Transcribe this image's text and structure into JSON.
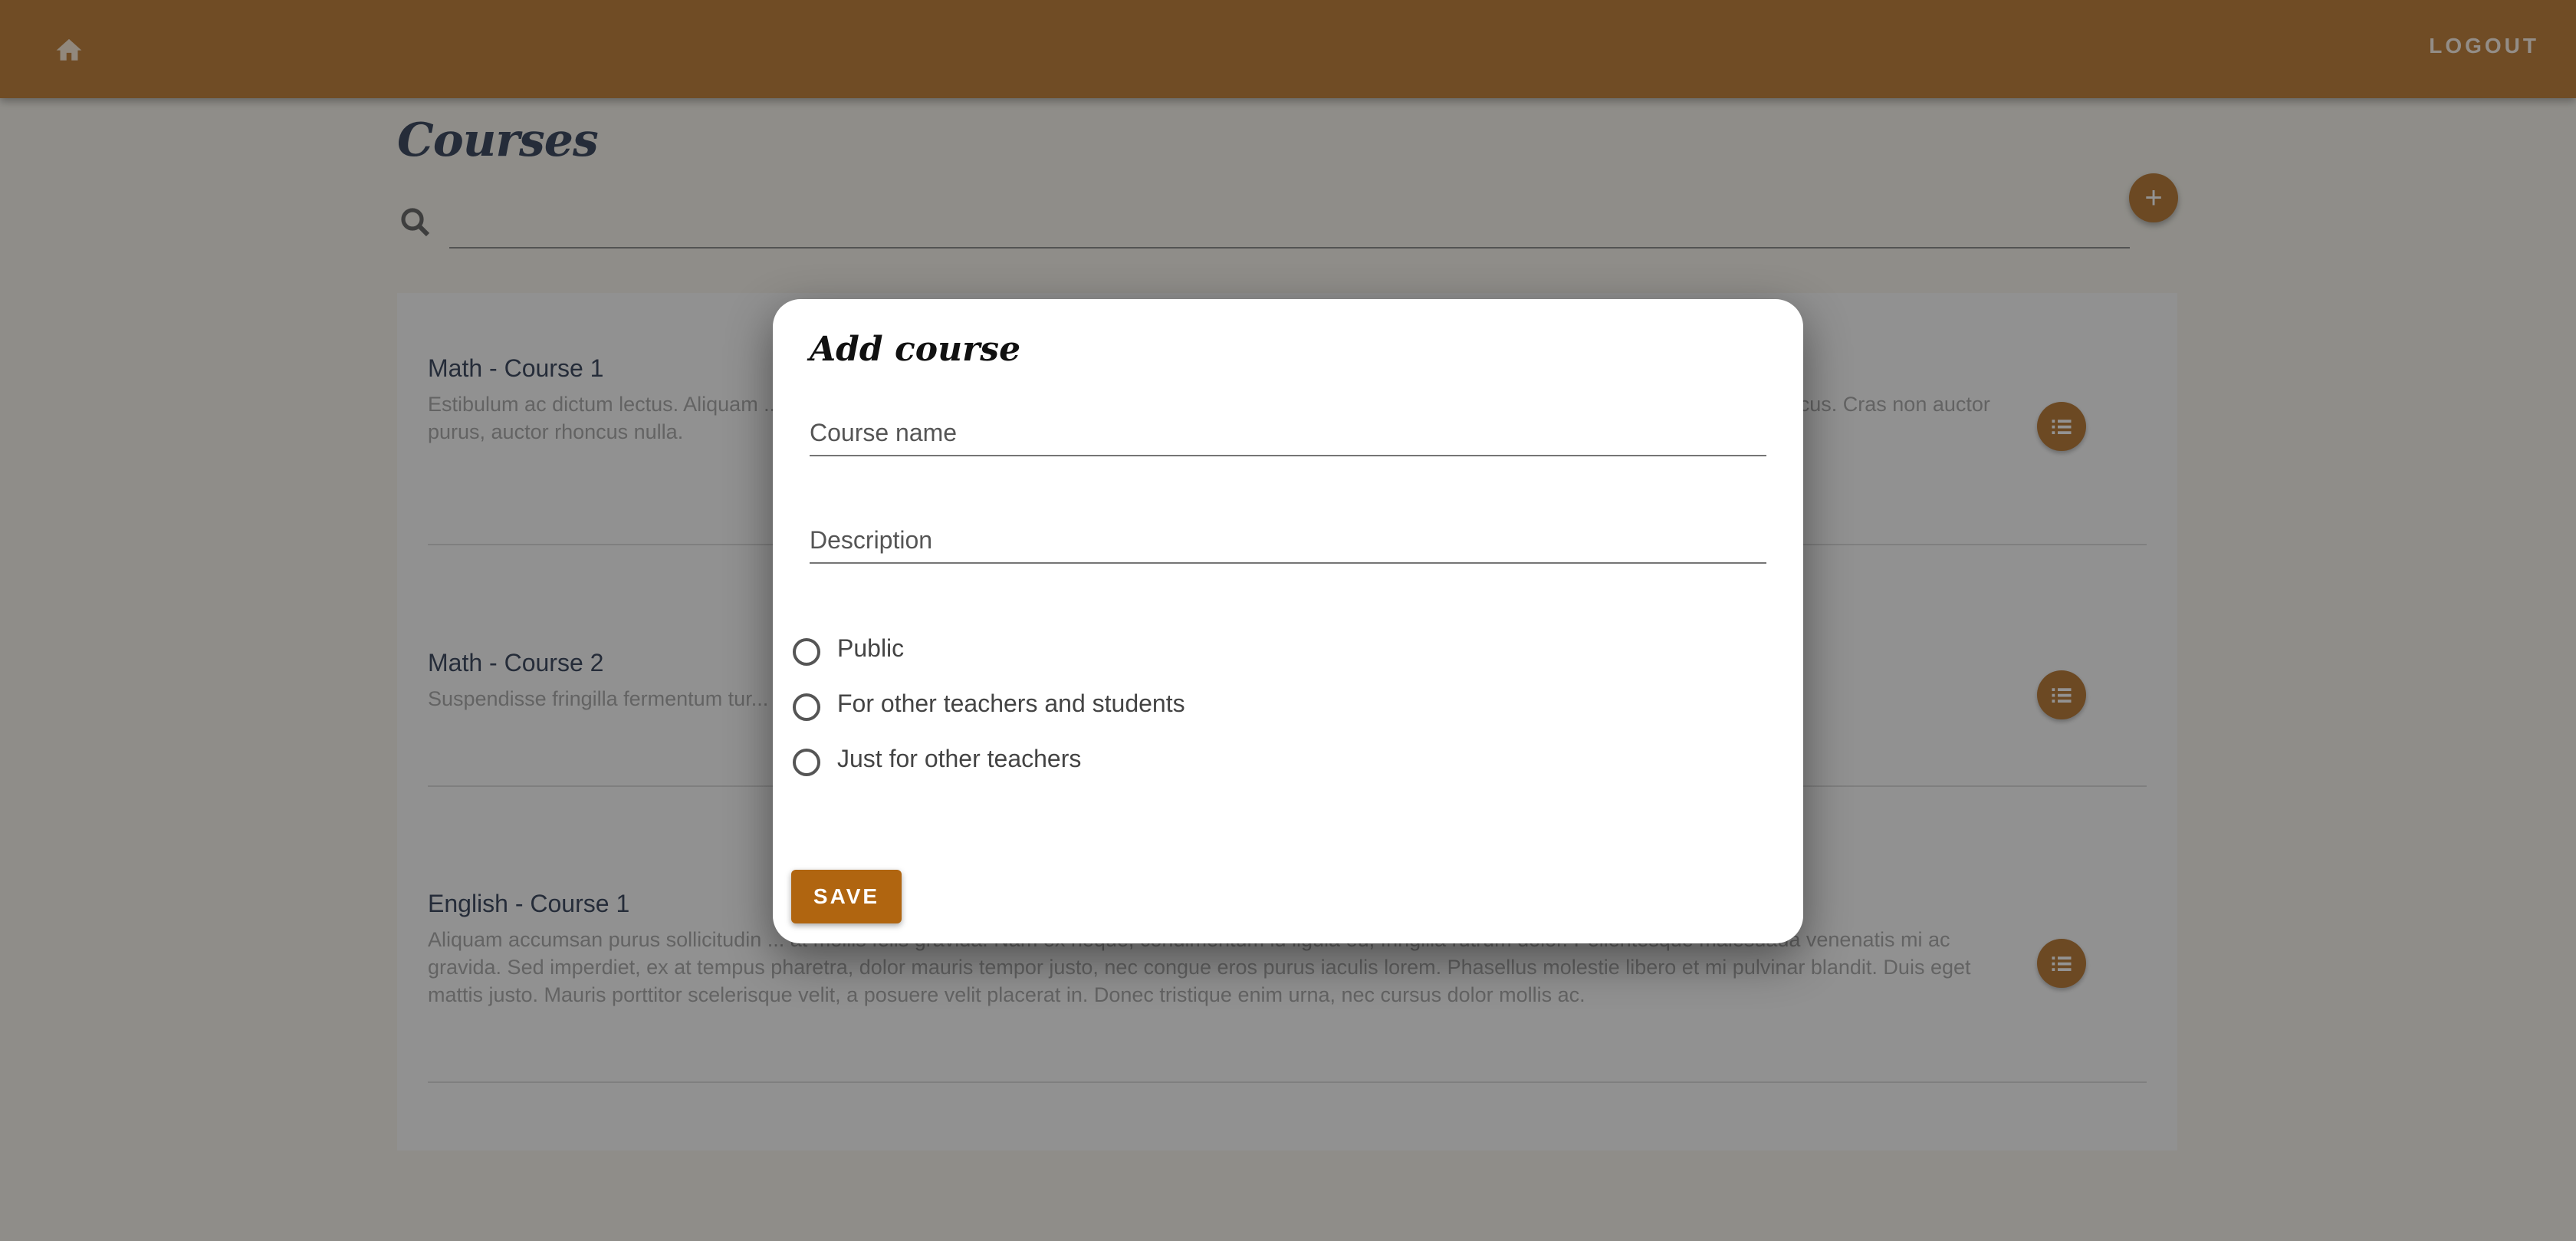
{
  "topbar": {
    "logout_label": "LOGOUT"
  },
  "page": {
    "title": "Courses",
    "search_placeholder": ""
  },
  "courses": [
    {
      "name": "Math - Course 1",
      "description": "Estibulum ac dictum lectus. Aliquam ... s semper. Nulla rutrum ligula feugiat condimentum e... auctor risus, at molestie arcu. Aenean in rutrum mi. ... lacus. Cras non auctor purus, auctor rhoncus nulla."
    },
    {
      "name": "Math - Course 2",
      "description": "Suspendisse fringilla fermentum tur... onec ullamcorper sit amet elit non convallis. Quisque tem... ibh sit amet rutrum."
    },
    {
      "name": "English - Course 1",
      "description": "Aliquam accumsan purus sollicitudin ... at mollis felis gravida. Nam ex neque, condimentum id ligula eu, fringilla rutrum dolor. Pellentesque malesuada venenatis mi ac gravida. Sed imperdiet, ex at tempus pharetra, dolor mauris tempor justo, nec congue eros purus iaculis lorem. Phasellus molestie libero et mi pulvinar blandit. Duis eget mattis justo. Mauris porttitor scelerisque velit, a posuere velit placerat in. Donec tristique enim urna, nec cursus dolor mollis ac."
    }
  ],
  "dialog": {
    "title": "Add course",
    "course_name_placeholder": "Course name",
    "description_placeholder": "Description",
    "visibility_options": [
      "Public",
      "For other teachers and students",
      "Just for other teachers"
    ],
    "save_label": "SAVE"
  },
  "colors": {
    "appbar": "#b87123",
    "accent": "#b06a1e",
    "save_button": "#b06510",
    "title_text": "#23314a"
  },
  "icons": {
    "home": "home-icon",
    "search": "search-icon",
    "add": "plus-icon",
    "list": "list-icon"
  }
}
